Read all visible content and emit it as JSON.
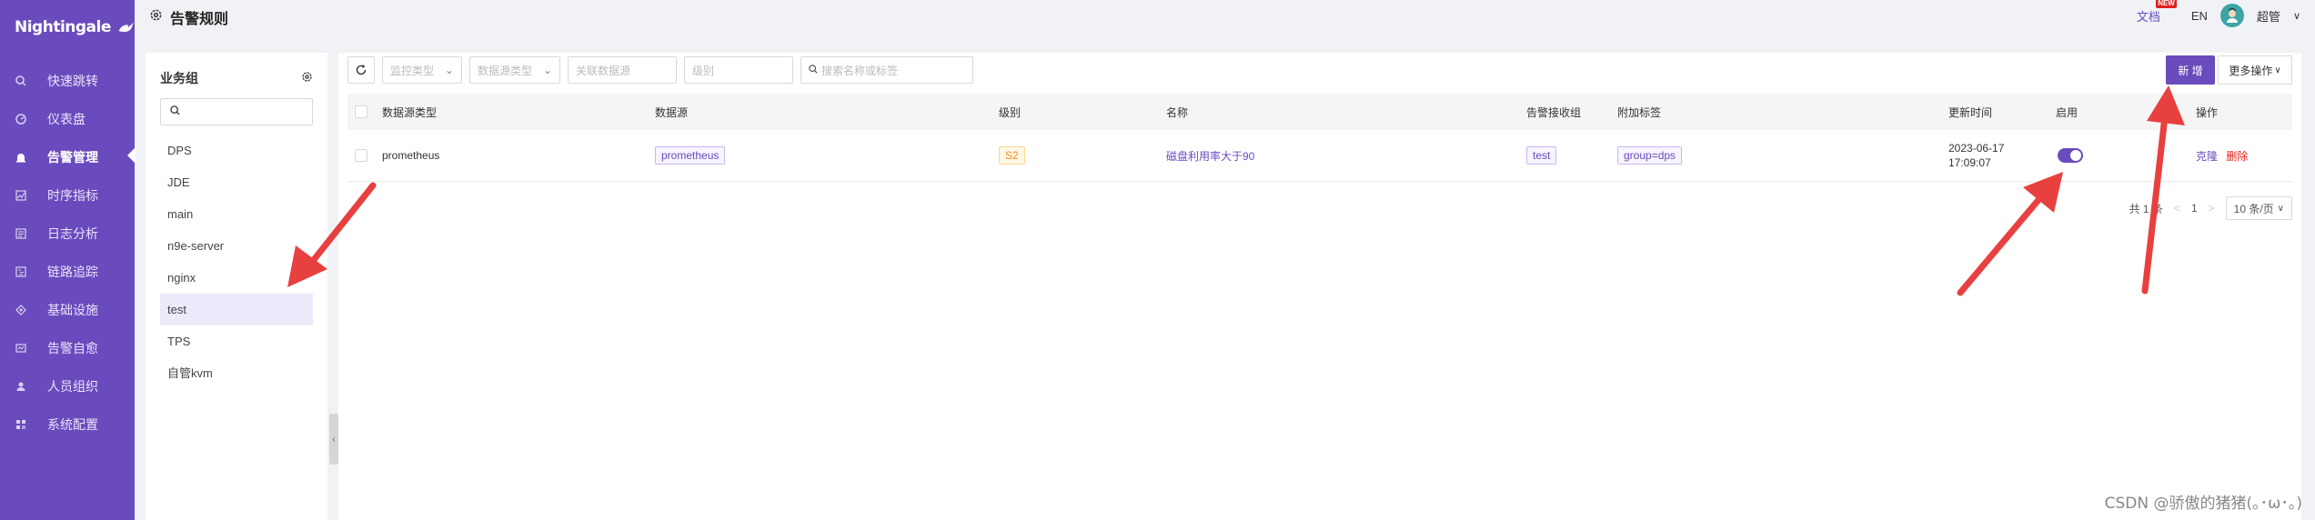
{
  "app": {
    "logo_text": "Nightingale"
  },
  "sidebar": {
    "items": [
      {
        "label": "快速跳转",
        "icon": "search-icon"
      },
      {
        "label": "仪表盘",
        "icon": "dashboard-icon"
      },
      {
        "label": "告警管理",
        "icon": "alarm-icon",
        "active": true
      },
      {
        "label": "时序指标",
        "icon": "chart-icon"
      },
      {
        "label": "日志分析",
        "icon": "log-icon"
      },
      {
        "label": "链路追踪",
        "icon": "trace-icon"
      },
      {
        "label": "基础设施",
        "icon": "infra-icon"
      },
      {
        "label": "告警自愈",
        "icon": "heal-icon"
      },
      {
        "label": "人员组织",
        "icon": "user-icon"
      },
      {
        "label": "系统配置",
        "icon": "settings-icon"
      }
    ]
  },
  "header": {
    "title": "告警规则",
    "doc_label": "文档",
    "new_badge": "NEW",
    "lang": "EN",
    "user": "超管"
  },
  "business_group": {
    "title": "业务组",
    "search_placeholder": "",
    "groups": [
      "DPS",
      "JDE",
      "main",
      "n9e-server",
      "nginx",
      "test",
      "TPS",
      "自管kvm"
    ],
    "selected": "test"
  },
  "toolbar": {
    "monitor_type_placeholder": "监控类型",
    "datasource_type_placeholder": "数据源类型",
    "related_datasource_placeholder": "关联数据源",
    "level_placeholder": "级别",
    "search_placeholder": "搜索名称或标签",
    "new_label": "新 增",
    "more_label": "更多操作"
  },
  "table": {
    "columns": [
      "数据源类型",
      "数据源",
      "级别",
      "名称",
      "告警接收组",
      "附加标签",
      "更新时间",
      "启用",
      "操作"
    ],
    "rows": [
      {
        "datasource_type": "prometheus",
        "datasource": "prometheus",
        "level": "S2",
        "name": "磁盘利用率大于90",
        "notify_group": "test",
        "append_tags": "group=dps",
        "update_date": "2023-06-17",
        "update_time": "17:09:07",
        "enabled": true,
        "action_clone": "克隆",
        "action_delete": "删除"
      }
    ]
  },
  "pagination": {
    "total": "共 1 条",
    "prev": "<",
    "page": "1",
    "next": ">",
    "page_size": "10 条/页"
  },
  "watermark": "CSDN @骄傲的猪猪(｡･ω･｡)",
  "colors": {
    "primary": "#6a4bbd",
    "arrow": "#e8403f",
    "danger": "#e0201d"
  }
}
